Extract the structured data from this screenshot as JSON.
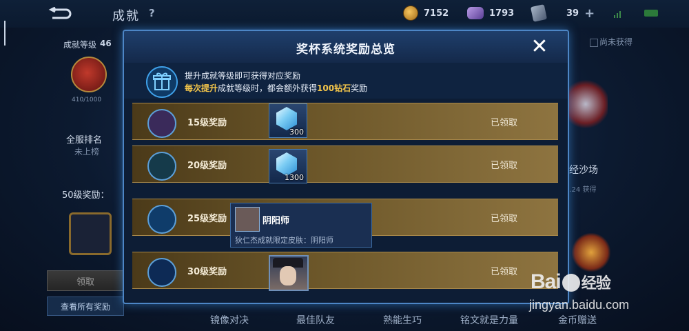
{
  "topbar": {
    "title": "成就",
    "help": "?",
    "coins": "7152",
    "gems": "1793",
    "tickets": "39",
    "plus": "+"
  },
  "background": {
    "level_label": "成就等级",
    "level_value": "46",
    "progress_text": "410/1000",
    "rank_label": "全服排名",
    "rank_value": "未上榜",
    "level50_label": "50级奖励：",
    "claim_button": "领取",
    "view_all_button": "查看所有奖励",
    "unobtained_label": "尚未获得",
    "right_title": "经沙场",
    "right_date": "4.24 获得",
    "tabs": [
      "镜像对决",
      "最佳队友",
      "熟能生巧",
      "铭文就是力量",
      "金币赠送"
    ]
  },
  "modal": {
    "title": "奖杯系统奖励总览",
    "close": "✕",
    "info_line1": "提升成就等级即可获得对应奖励",
    "info_line2_a": "每次提升",
    "info_line2_b": "成就等级时，都会额外获得",
    "info_line2_c": "100钻石",
    "info_line2_d": "奖励",
    "rows": [
      {
        "label": "15级奖励",
        "status": "已领取",
        "reward_qty": "300"
      },
      {
        "label": "20级奖励",
        "status": "已领取",
        "reward_qty": "1300"
      },
      {
        "label": "25级奖励",
        "status": "已领取"
      },
      {
        "label": "30级奖励",
        "status": "已领取"
      }
    ],
    "tooltip": {
      "title": "阴阳师",
      "desc": "狄仁杰成就限定皮肤：阴阳师"
    }
  },
  "watermark": {
    "logo_a": "Bai",
    "logo_b": "经验",
    "url": "jingyan.baidu.com"
  }
}
